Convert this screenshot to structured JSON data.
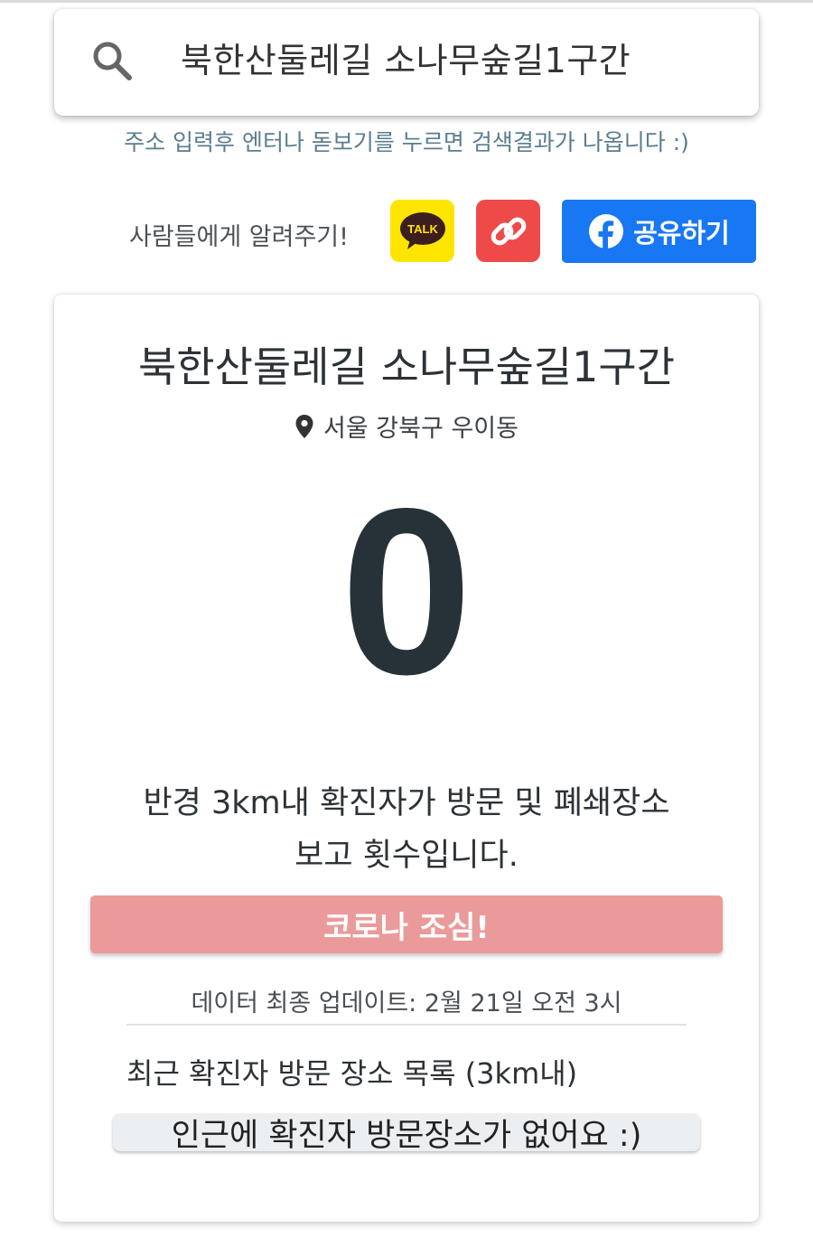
{
  "search": {
    "query": "북한산둘레길 소나무숲길1구간",
    "hint": "주소 입력후 엔터나 돋보기를 누르면 검색결과가 나옵니다 :)"
  },
  "share": {
    "label": "사람들에게 알려주기!",
    "kakao_label": "TALK",
    "facebook_label": "공유하기"
  },
  "place": {
    "title": "북한산둘레길 소나무숲길1구간",
    "location": "서울 강북구 우이동",
    "count": "0",
    "description_line1": "반경 3km내 확진자가 방문 및 폐쇄장소",
    "description_line2": "보고 횟수입니다.",
    "warning_button": "코로나 조심!",
    "updated": "데이터 최종 업데이트: 2월 21일 오전 3시"
  },
  "visits": {
    "title": "최근 확진자 방문 장소 목록 (3km내)",
    "empty_message": "인근에 확진자 방문장소가 없어요 :)"
  },
  "colors": {
    "kakao": "#fee500",
    "link": "#ee4a4a",
    "facebook": "#1877f2",
    "warning": "#eb9a9a",
    "count": "#263238"
  }
}
